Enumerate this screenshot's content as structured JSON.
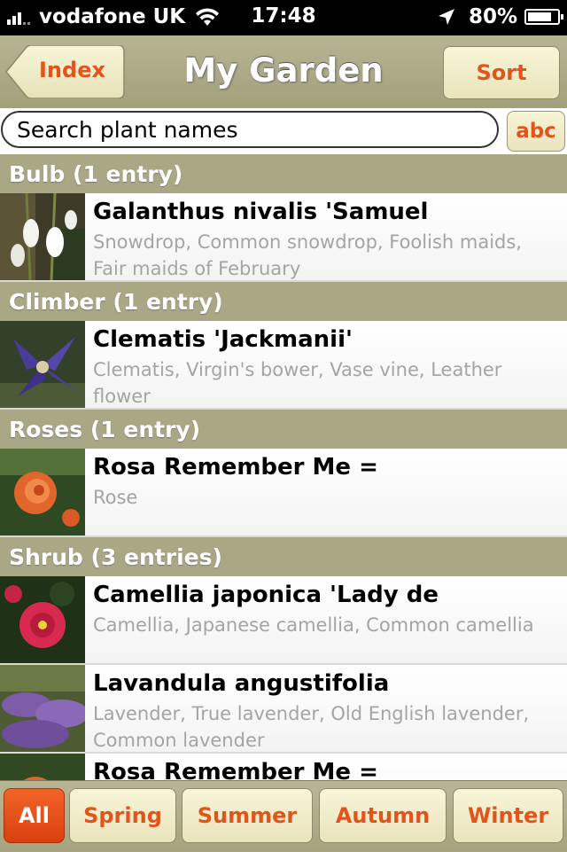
{
  "status": {
    "carrier": "vodafone UK",
    "time": "17:48",
    "battery": "80%"
  },
  "nav": {
    "back_label": "Index",
    "title": "My Garden",
    "sort_label": "Sort"
  },
  "search": {
    "placeholder": "Search plant names",
    "abc_label": "abc"
  },
  "sections": [
    {
      "header": "Bulb (1 entry)",
      "items": [
        {
          "title": "Galanthus nivalis 'Samuel",
          "subtitle": "Snowdrop, Common snowdrop, Foolish maids, Fair maids of February"
        }
      ]
    },
    {
      "header": "Climber (1 entry)",
      "items": [
        {
          "title": "Clematis 'Jackmanii'",
          "subtitle": "Clematis, Virgin's bower, Vase vine, Leather flower"
        }
      ]
    },
    {
      "header": "Roses (1 entry)",
      "items": [
        {
          "title": "Rosa Remember Me =",
          "subtitle": "Rose"
        }
      ]
    },
    {
      "header": "Shrub (3 entries)",
      "items": [
        {
          "title": "Camellia japonica 'Lady de",
          "subtitle": "Camellia, Japanese camellia, Common camellia"
        },
        {
          "title": "Lavandula angustifolia",
          "subtitle": "Lavender, True lavender, Old English lavender, Common lavender"
        },
        {
          "title": "Rosa Remember Me =",
          "subtitle": ""
        }
      ]
    }
  ],
  "filters": {
    "all": "All",
    "spring": "Spring",
    "summer": "Summer",
    "autumn": "Autumn",
    "winter": "Winter",
    "selected": "All"
  },
  "colors": {
    "accent": "#e2541b",
    "bar": "#a9a784",
    "button_bg": "#f3efcd"
  }
}
